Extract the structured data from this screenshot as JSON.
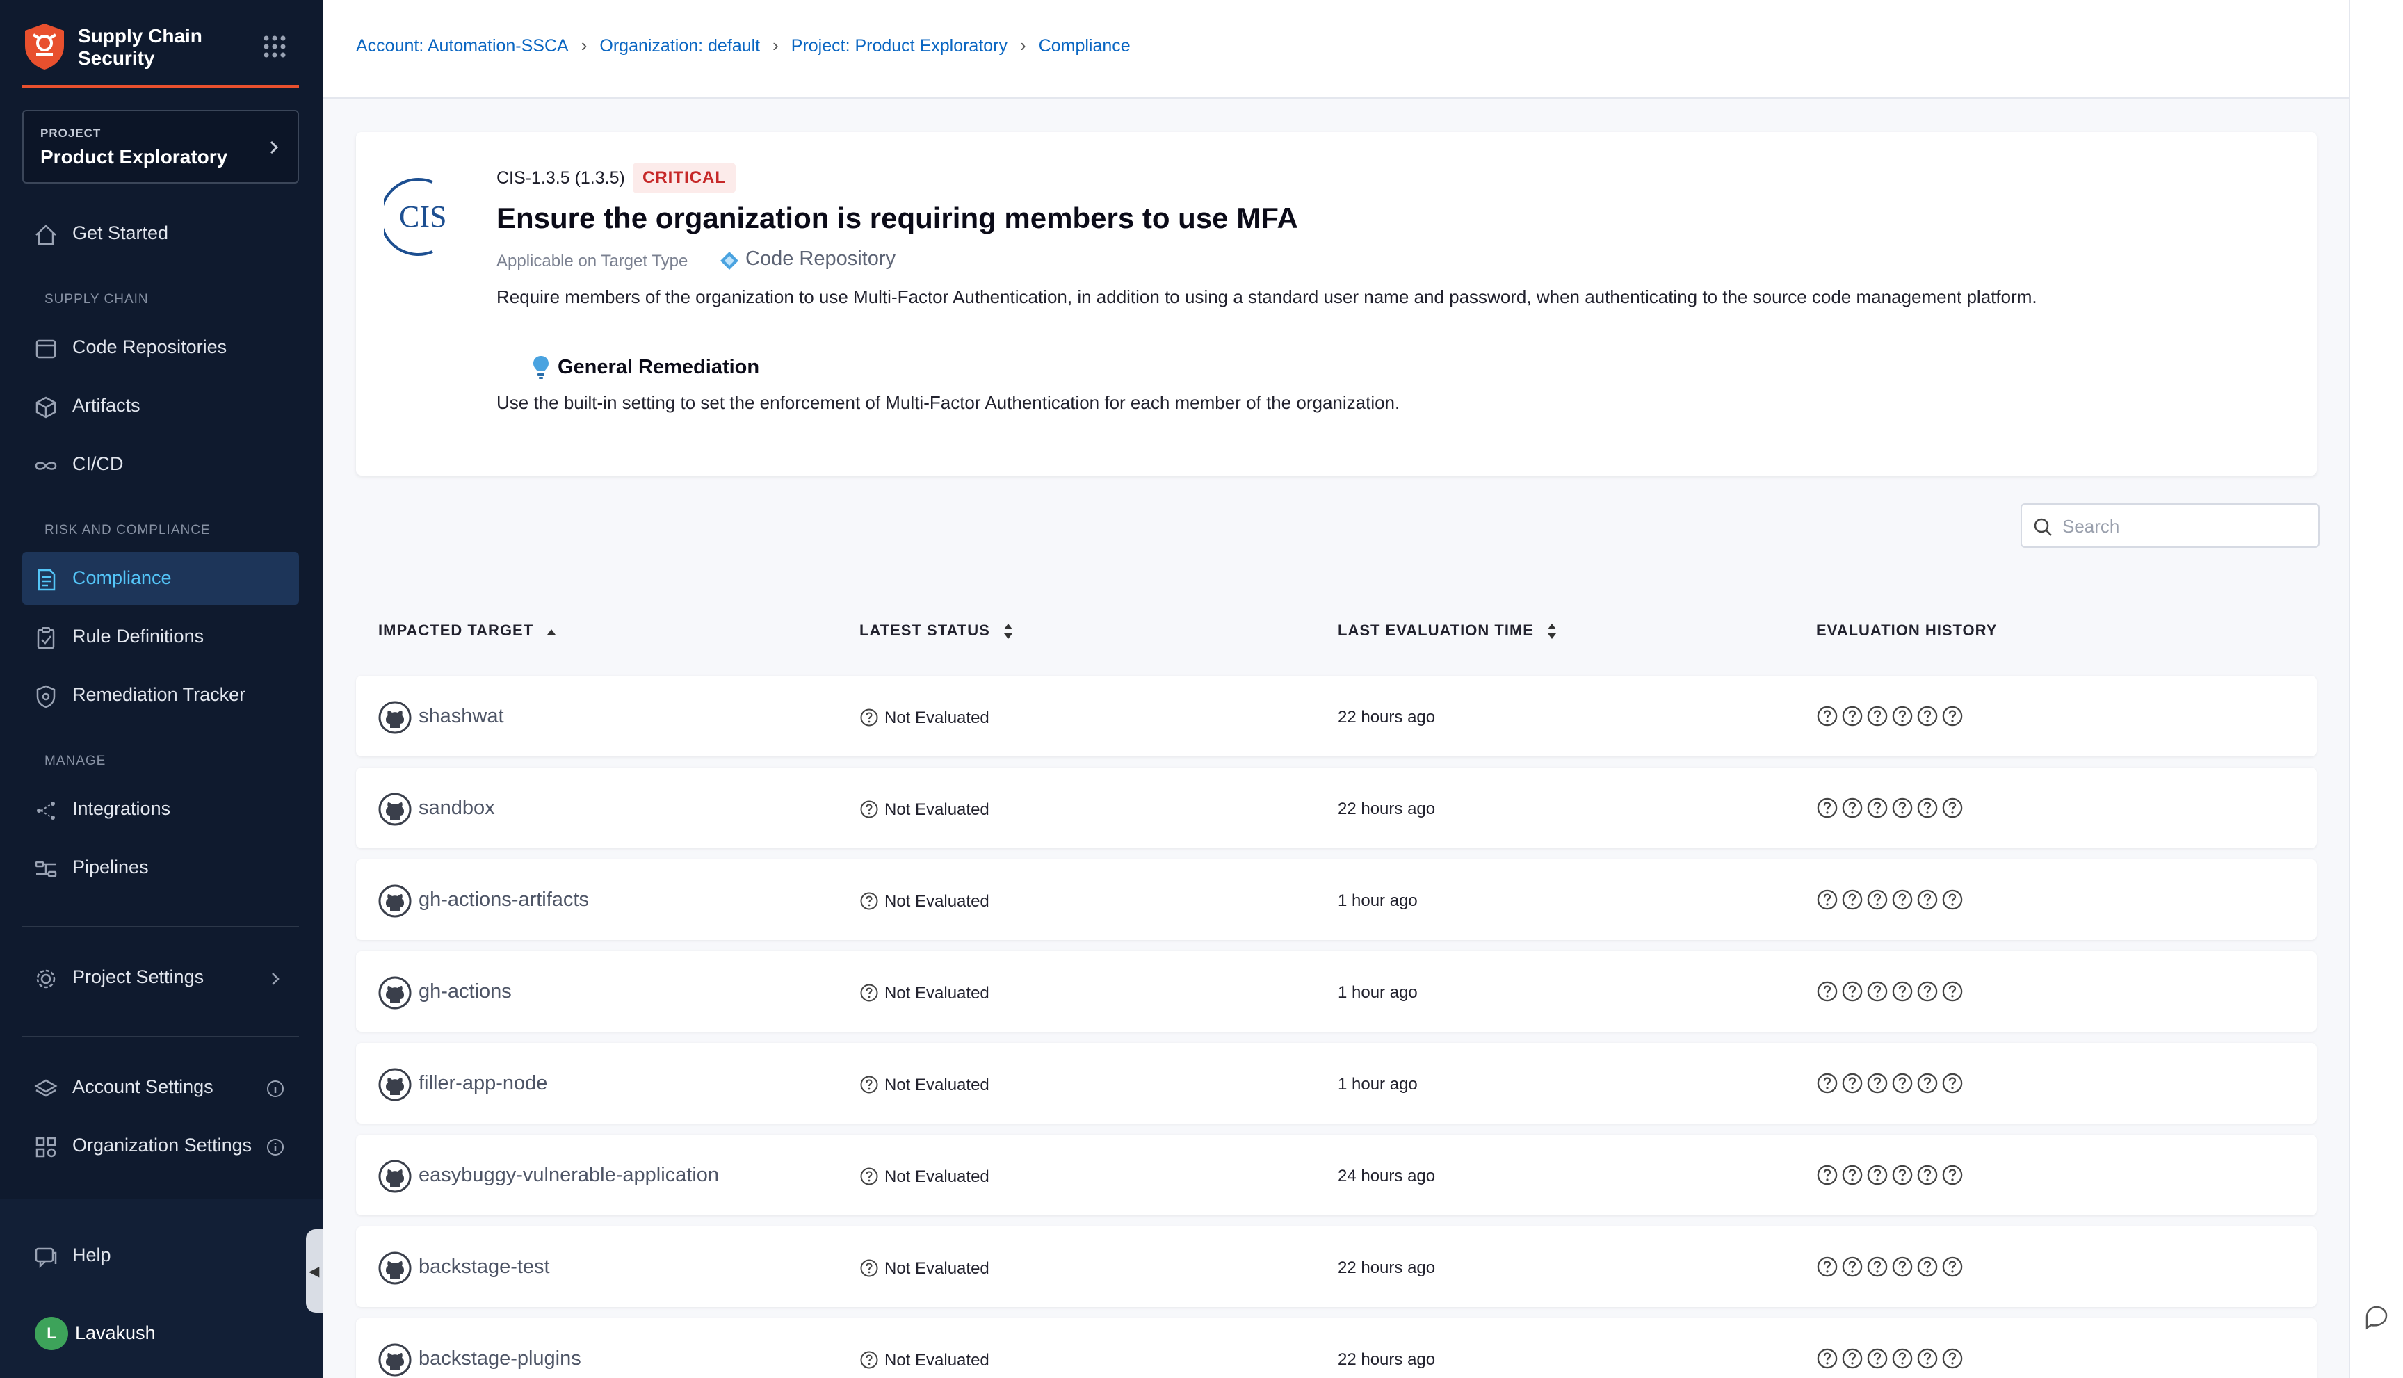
{
  "app": {
    "title": "Supply Chain Security"
  },
  "project": {
    "kicker": "PROJECT",
    "name": "Product Exploratory"
  },
  "nav": {
    "get_started": "Get Started",
    "supply_chain_hd": "SUPPLY CHAIN",
    "code_repos": "Code Repositories",
    "artifacts": "Artifacts",
    "cicd": "CI/CD",
    "risk_hd": "RISK AND COMPLIANCE",
    "compliance": "Compliance",
    "rule_definitions": "Rule Definitions",
    "remediation": "Remediation Tracker",
    "manage_hd": "MANAGE",
    "integrations": "Integrations",
    "pipelines": "Pipelines",
    "project_settings": "Project Settings",
    "account_settings": "Account Settings",
    "org_settings": "Organization Settings",
    "help": "Help"
  },
  "user": {
    "initial": "L",
    "name": "Lavakush"
  },
  "breadcrumb": [
    "Account: Automation-SSCA",
    "Organization: default",
    "Project: Product Exploratory",
    "Compliance"
  ],
  "rule": {
    "id": "CIS-1.3.5 (1.3.5)",
    "severity": "CRITICAL",
    "title": "Ensure the organization is requiring members to use MFA",
    "applicable_label": "Applicable on Target Type",
    "target_type": "Code Repository",
    "description": "Require members of the organization to use Multi-Factor Authentication, in addition to using a standard user name and password, when authenticating to the source code management platform.",
    "remediation_title": "General Remediation",
    "remediation_text": "Use the built-in setting to set the enforcement of Multi-Factor Authentication for each member of the organization.",
    "logo_text": "CIS"
  },
  "search": {
    "placeholder": "Search"
  },
  "table": {
    "headers": [
      "IMPACTED TARGET",
      "LATEST STATUS",
      "LAST EVALUATION TIME",
      "EVALUATION HISTORY"
    ],
    "rows": [
      {
        "target": "shashwat",
        "status": "Not Evaluated",
        "time": "22 hours ago"
      },
      {
        "target": "sandbox",
        "status": "Not Evaluated",
        "time": "22 hours ago"
      },
      {
        "target": "gh-actions-artifacts",
        "status": "Not Evaluated",
        "time": "1 hour ago"
      },
      {
        "target": "gh-actions",
        "status": "Not Evaluated",
        "time": "1 hour ago"
      },
      {
        "target": "filler-app-node",
        "status": "Not Evaluated",
        "time": "1 hour ago"
      },
      {
        "target": "easybuggy-vulnerable-application",
        "status": "Not Evaluated",
        "time": "24 hours ago"
      },
      {
        "target": "backstage-test",
        "status": "Not Evaluated",
        "time": "22 hours ago"
      },
      {
        "target": "backstage-plugins",
        "status": "Not Evaluated",
        "time": "22 hours ago"
      }
    ]
  },
  "colors": {
    "accent": "#0a66c2",
    "sidebar": "#0f1a2e",
    "brand": "#e8502e",
    "critical": "#c62828"
  }
}
